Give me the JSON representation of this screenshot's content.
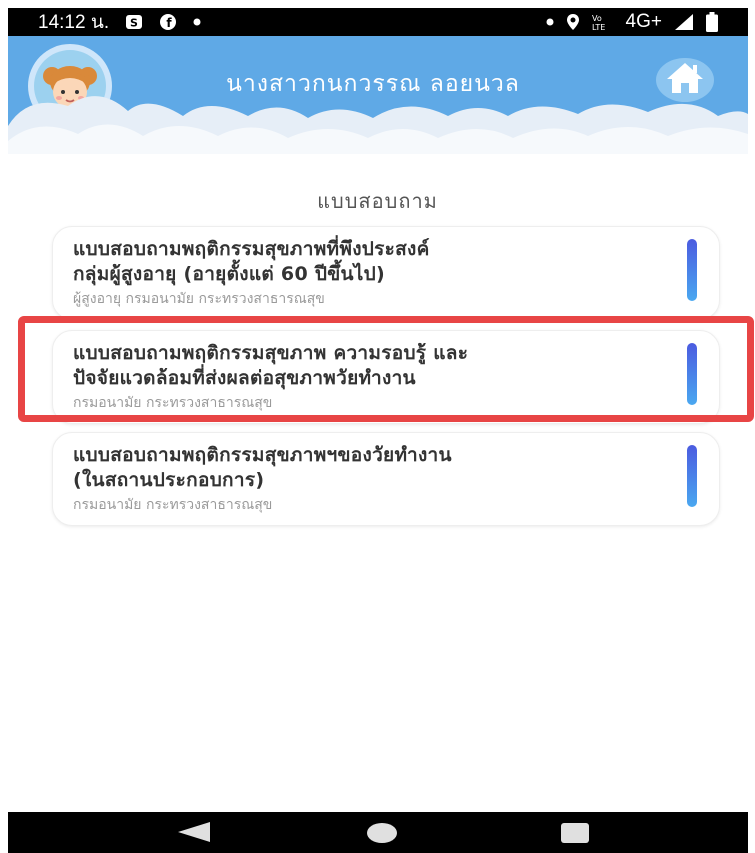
{
  "status_bar": {
    "time": "14:12 น.",
    "network": "4G+",
    "icons": [
      "samsung-pay-icon",
      "facebook-icon",
      "dot-icon",
      "dot-icon",
      "location-icon",
      "volte-icon",
      "signal-icon",
      "battery-icon"
    ]
  },
  "header": {
    "user_name": "นางสาวกนกวรรณ ลอยนวล",
    "home_icon": "home-icon",
    "avatar_icon": "avatar-girl-icon"
  },
  "section_title": "แบบสอบถาม",
  "cards": [
    {
      "title_line1": "แบบสอบถามพฤติกรรมสุขภาพที่พึงประสงค์",
      "title_line2": "กลุ่มผู้สูงอายุ (อายุตั้งแต่ 60 ปีขึ้นไป)",
      "subtitle": "ผู้สูงอายุ กรมอนามัย กระทรวงสาธารณสุข",
      "highlighted": false
    },
    {
      "title_line1": "แบบสอบถามพฤติกรรมสุขภาพ ความรอบรู้ และ",
      "title_line2": "ปัจจัยแวดล้อมที่ส่งผลต่อสุขภาพวัยทำงาน",
      "subtitle": "กรมอนามัย กระทรวงสาธารณสุข",
      "highlighted": true
    },
    {
      "title_line1": "แบบสอบถามพฤติกรรมสุขภาพฯของวัยทำงาน",
      "title_line2": "(ในสถานประกอบการ)",
      "subtitle": "กรมอนามัย กระทรวงสาธารณสุข",
      "highlighted": false
    }
  ],
  "colors": {
    "header_blue": "#5fa9e6",
    "card_bar_top": "#4b5be0",
    "card_bar_bottom": "#4aa8f0",
    "highlight_red": "#e84545"
  },
  "nav_bar": {
    "buttons": [
      "back-icon",
      "home-circle-icon",
      "recents-icon"
    ]
  }
}
